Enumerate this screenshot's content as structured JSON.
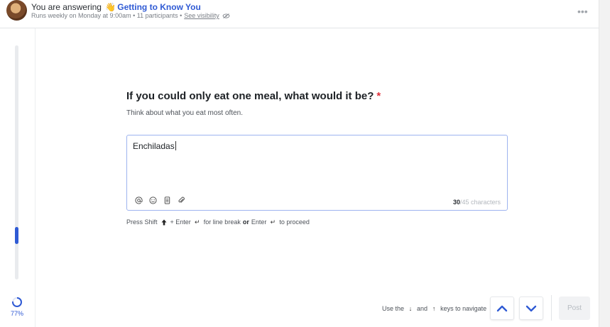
{
  "header": {
    "prefix": "You are answering",
    "wave_emoji": "👋",
    "survey_name": "Getting to Know You",
    "schedule": "Runs weekly on Monday at 9:00am • 11 participants •",
    "visibility_link": "See visibility",
    "more_label": "•••"
  },
  "progress": {
    "percent_label": "77%",
    "percent_value": 77
  },
  "question": {
    "title": "If you could only eat one meal, what would it be?",
    "required_mark": "*",
    "helper": "Think about what you eat most often."
  },
  "answer": {
    "value": "Enchiladas",
    "char_count": "30",
    "char_limit_text": "/45 characters"
  },
  "hint": {
    "press": "Press Shift",
    "shift_glyph": "🠅",
    "plus_enter": "+ Enter",
    "enter_glyph": "↵",
    "line_break": "for line break",
    "or": "or",
    "enter": "Enter",
    "proceed": "to proceed"
  },
  "footer": {
    "use_the": "Use the",
    "down_glyph": "↓",
    "and": "and",
    "up_glyph": "↑",
    "keys_to_navigate": "keys to navigate",
    "post_label": "Post"
  },
  "colors": {
    "accent": "#2f5ad4",
    "required": "#e0323c"
  }
}
